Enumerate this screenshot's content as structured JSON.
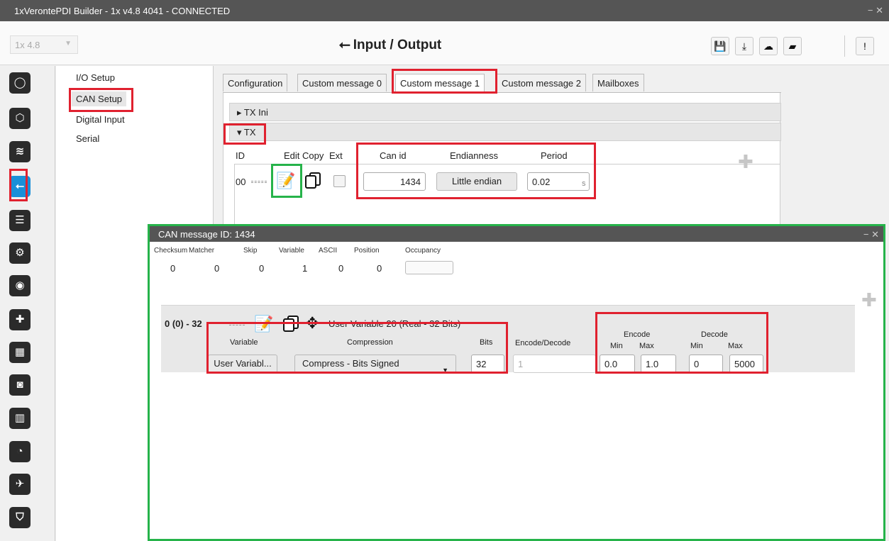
{
  "window": {
    "title": "1xVerontePDI Builder - 1x v4.8 4041 - CONNECTED",
    "controls": "− ✕"
  },
  "header": {
    "version": "1x 4.8",
    "title": "Input / Output",
    "toolbar_icons": [
      "save-icon",
      "download-icon",
      "cloud-upload-icon",
      "folder-open-icon",
      "info-icon"
    ]
  },
  "iconbar": {
    "items": [
      "power-icon",
      "sphere-icon",
      "rss-icon",
      "usb-icon",
      "sliders-icon",
      "gears-icon",
      "broadcast-icon",
      "gamepad-icon",
      "grid-icon",
      "camera-icon",
      "chart-icon",
      "gauge-icon",
      "plane-icon",
      "shield-icon"
    ],
    "active_index": 3
  },
  "setup_list": {
    "items": [
      "I/O Setup",
      "CAN Setup",
      "Digital Input",
      "Serial"
    ],
    "selected": "CAN Setup"
  },
  "tabs": [
    "Configuration",
    "Custom message 0",
    "Custom message 1",
    "Custom message 2",
    "Mailboxes"
  ],
  "active_tab": "Custom message 1",
  "accordion": {
    "tx_ini": "TX Ini",
    "tx": "TX"
  },
  "tx_columns": {
    "id": "ID",
    "edit": "Edit",
    "copy": "Copy",
    "ext": "Ext",
    "can_id": "Can id",
    "endianness": "Endianness",
    "period": "Period"
  },
  "tx_row": {
    "id": "00",
    "can_id": "1434",
    "endianness": "Little endian",
    "period": "0.02",
    "period_unit": "s"
  },
  "dialog": {
    "title": "CAN message ID: 1434",
    "controls": "− ✕",
    "stats": [
      {
        "label": "Checksum",
        "value": "0"
      },
      {
        "label": "Matcher",
        "value": "0"
      },
      {
        "label": "Skip",
        "value": "0"
      },
      {
        "label": "Variable",
        "value": "1"
      },
      {
        "label": "ASCII",
        "value": "0"
      },
      {
        "label": "Position",
        "value": "0"
      },
      {
        "label": "Occupancy",
        "value": ""
      }
    ],
    "field": {
      "range": "0 (0) - 32",
      "description": "User Variable 20 (Real - 32 Bits)",
      "headers": {
        "variable": "Variable",
        "compression": "Compression",
        "bits": "Bits",
        "encode_decode": "Encode/Decode",
        "encode": "Encode",
        "decode": "Decode",
        "min": "Min",
        "max": "Max"
      },
      "variable_btn": "User Variabl...",
      "compression": "Compress - Bits Signed",
      "bits": "32",
      "encode_decode_placeholder": "1",
      "encode_min": "0.0",
      "encode_max": "1.0",
      "decode_min": "0",
      "decode_max": "5000"
    }
  },
  "colors": {
    "highlight_red": "#e0212f",
    "highlight_green": "#26b34a",
    "active_icon": "#1a8fd8",
    "titlebar": "#555555"
  }
}
